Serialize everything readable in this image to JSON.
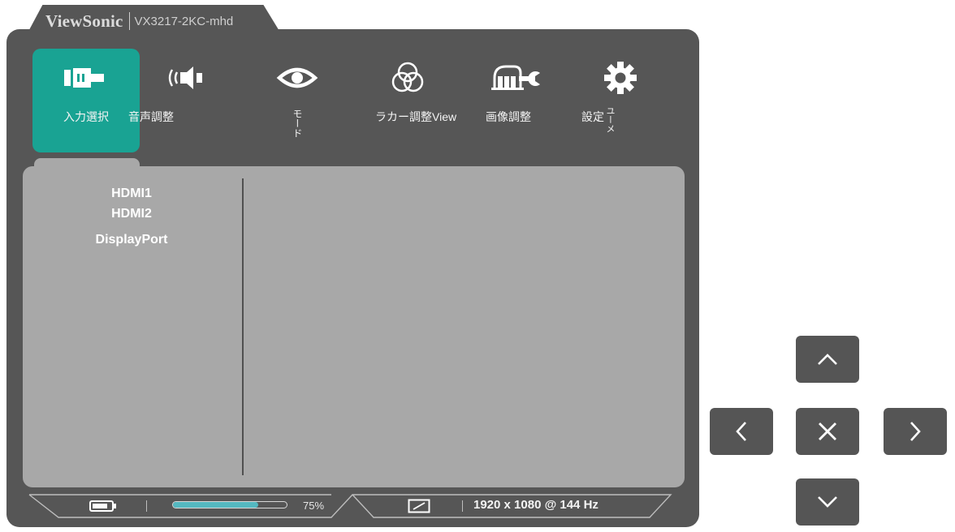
{
  "title_bar": {
    "brand": "ViewSonic",
    "model": "VX3217-2KC-mhd"
  },
  "menu": {
    "items": [
      {
        "label": "入力選択",
        "icon": "input-source-icon",
        "active": true
      },
      {
        "label": "音声調整",
        "icon": "audio-speaker-icon",
        "active": false
      },
      {
        "label": "モード",
        "icon": "eye-icon",
        "active": false
      },
      {
        "label": "ラカー調整View",
        "icon": "color-circles-icon",
        "active": false
      },
      {
        "label": "画像調整",
        "icon": "image-adjust-icon",
        "active": false
      },
      {
        "label": "設定",
        "label_vertical_suffix": "ユーメ",
        "icon": "gear-icon",
        "active": false
      }
    ]
  },
  "input_sources": {
    "options": [
      "HDMI1",
      "HDMI2",
      "DisplayPort"
    ]
  },
  "status_bar": {
    "volume_percent": 75,
    "volume_text": "75%",
    "resolution": "1920 x 1080 @ 144 Hz",
    "battery_icon": "battery-icon",
    "aspect_icon": "aspect-ratio-icon"
  },
  "dpad": {
    "up_icon": "chevron-up-icon",
    "down_icon": "chevron-down-icon",
    "left_icon": "chevron-left-icon",
    "right_icon": "chevron-right-icon",
    "center_icon": "close-icon"
  },
  "colors": {
    "frame": "#565656",
    "panel": "#a8a8a8",
    "active_tab": "#19a393",
    "volume_fill": "#54b8c0",
    "button": "#555555"
  }
}
